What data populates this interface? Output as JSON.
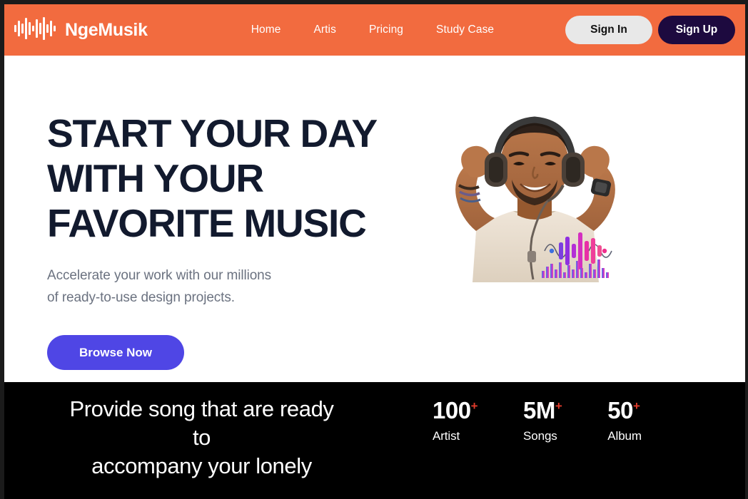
{
  "header": {
    "logo_icon": "audio-waveform-icon",
    "brand_name": "NgeMusik",
    "nav": [
      {
        "label": "Home"
      },
      {
        "label": "Artis"
      },
      {
        "label": "Pricing"
      },
      {
        "label": "Study Case"
      }
    ],
    "sign_in_label": "Sign In",
    "sign_up_label": "Sign Up",
    "background_color": "#f26b3f",
    "sign_in_color": "#e8e8e8",
    "sign_up_color": "#1d0a3f"
  },
  "hero": {
    "headline_line1": "START YOUR DAY",
    "headline_line2": "WITH YOUR",
    "headline_line3": "FAVORITE MUSIC",
    "subtitle_line1": "Accelerate your work with our millions",
    "subtitle_line2": "of ready-to-use design projects.",
    "cta_label": "Browse Now",
    "cta_color": "#4f46e5",
    "headline_color": "#121a2e",
    "subtitle_color": "#6b7280",
    "image_alt": "smiling-man-wearing-headphones"
  },
  "band": {
    "tagline_line1": "Provide song that are ready",
    "tagline_line2": "to",
    "tagline_line3": "accompany your lonely",
    "background_color": "#000000",
    "plus_color": "#e03b2b",
    "stats": [
      {
        "value": "100",
        "suffix": "+",
        "label": "Artist"
      },
      {
        "value": "5M",
        "suffix": "+",
        "label": "Songs"
      },
      {
        "value": "50",
        "suffix": "+",
        "label": "Album"
      }
    ]
  }
}
